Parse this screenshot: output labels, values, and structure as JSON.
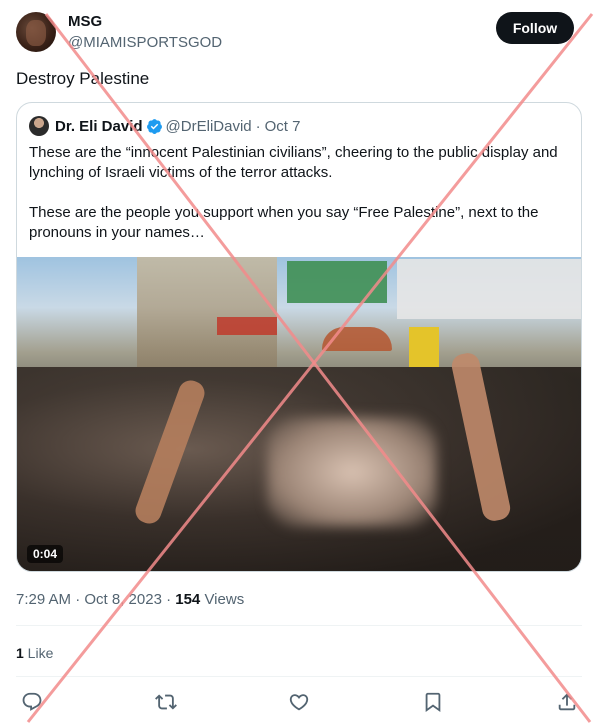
{
  "author": {
    "display_name": "MSG",
    "handle": "@MIAMISPORTSGOD",
    "follow_label": "Follow"
  },
  "tweet": {
    "text": "Destroy Palestine",
    "timestamp": "7:29 AM · Oct 8, 2023 · ",
    "views_count": "154",
    "views_label": " Views",
    "likes_count": "1",
    "likes_label": " Like"
  },
  "quoted_tweet": {
    "display_name": "Dr. Eli David",
    "handle": "@DrEliDavid",
    "date": "Oct 7",
    "paragraph_1": "These are the “innocent Palestinian civilians”, cheering to the public display and lynching of Israeli victims of the terror attacks.",
    "paragraph_2": "These are the people you support when you say “Free Palestine”, next to the pronouns in your names…",
    "video_duration": "0:04"
  },
  "icons": {
    "verified": "verified-badge-icon",
    "reply": "reply-icon",
    "retweet": "retweet-icon",
    "like": "heart-icon",
    "bookmark": "bookmark-icon",
    "share": "share-icon"
  },
  "colors": {
    "accent": "#1d9bf0",
    "cross_overlay": "#f28b8b",
    "secondary_text": "#536471"
  }
}
